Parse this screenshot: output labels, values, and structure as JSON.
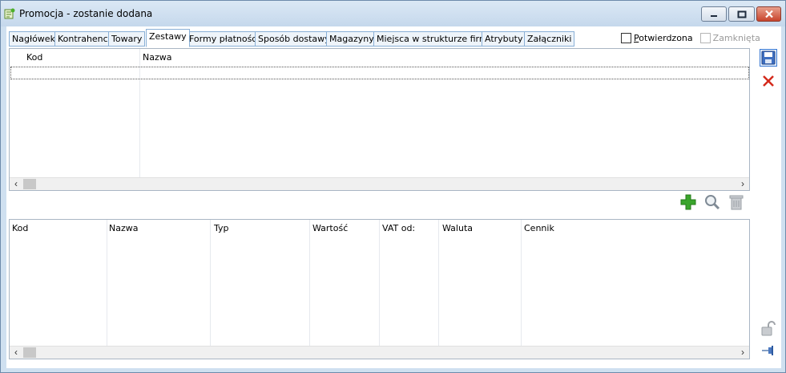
{
  "window": {
    "title": "Promocja - zostanie dodana"
  },
  "tabs": [
    {
      "label": "Nagłówek"
    },
    {
      "label": "Kontrahenci"
    },
    {
      "label": "Towary"
    },
    {
      "label": "Zestawy",
      "active": true
    },
    {
      "label": "Formy płatności"
    },
    {
      "label": "Sposób dostawy"
    },
    {
      "label": "Magazyny"
    },
    {
      "label": "Miejsca w strukturze firmy"
    },
    {
      "label": "Atrybuty"
    },
    {
      "label": "Załączniki"
    }
  ],
  "checkboxes": {
    "potwierdzona": {
      "label": "Potwierdzona",
      "checked": false,
      "enabled": true
    },
    "zamknieta": {
      "label": "Zamknięta",
      "checked": false,
      "enabled": false
    }
  },
  "sets_grid": {
    "columns": [
      "Kod",
      "Nazwa"
    ],
    "rows": []
  },
  "elements_grid": {
    "columns": [
      "Kod",
      "Nazwa",
      "Typ",
      "Wartość",
      "VAT od:",
      "Waluta",
      "Cennik"
    ],
    "rows": []
  },
  "icons": {
    "app": "promotion-icon",
    "save": "floppy-disk-icon",
    "cancel": "red-x-icon",
    "add": "green-plus-icon",
    "search": "magnifier-icon",
    "delete": "trash-icon",
    "lock": "padlock-icon",
    "pin": "pin-icon"
  },
  "colors": {
    "window_frame": "#cfe0f0",
    "tab_border": "#8ab0d6",
    "close_button": "#c8442c",
    "add_green": "#3aa52c",
    "cancel_red": "#d42a1c"
  }
}
